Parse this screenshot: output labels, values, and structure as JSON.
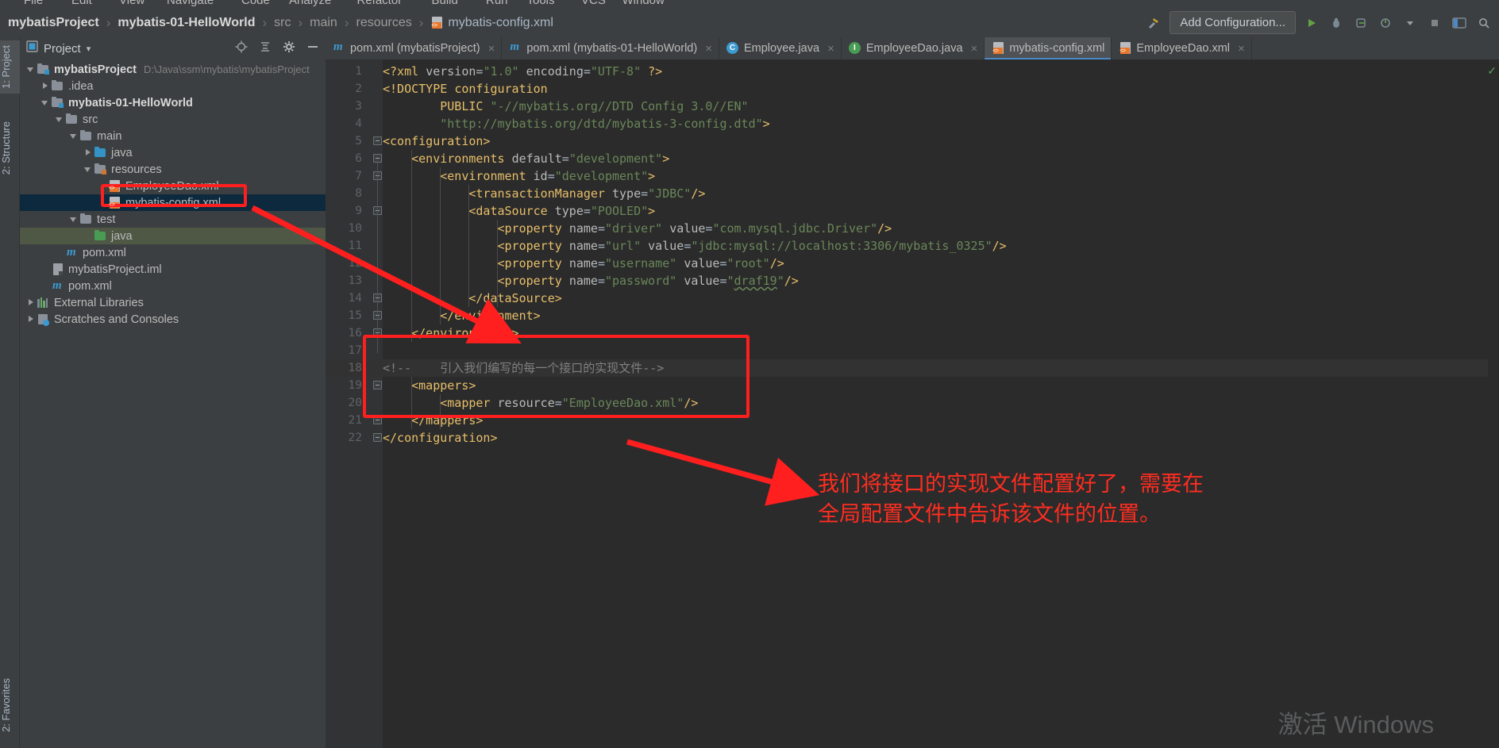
{
  "menu": {
    "items": [
      "File",
      "Edit",
      "View",
      "Navigate",
      "Code",
      "Analyze",
      "Refactor",
      "Build",
      "Run",
      "Tools",
      "VCS",
      "Window"
    ]
  },
  "breadcrumb": {
    "items": [
      {
        "label": "mybatisProject",
        "style": "bold"
      },
      {
        "label": "mybatis-01-HelloWorld",
        "style": "bold"
      },
      {
        "label": "src",
        "style": "dim"
      },
      {
        "label": "main",
        "style": "dim"
      },
      {
        "label": "resources",
        "style": "dim"
      },
      {
        "label": "mybatis-config.xml",
        "style": "file"
      }
    ],
    "separator": "›"
  },
  "toolbar": {
    "add_configuration": "Add Configuration...",
    "icons": [
      "hammer-icon",
      "run-icon",
      "debug-icon",
      "coverage-icon",
      "profile-icon",
      "dropdown-icon",
      "stop-icon",
      "layout-icon",
      "search-icon"
    ]
  },
  "left_strip": {
    "tabs": [
      {
        "label": "1: Project",
        "active": true
      },
      {
        "label": "2: Structure",
        "active": false
      }
    ],
    "favorites": "2: Favorites"
  },
  "project_panel": {
    "title": "Project",
    "dropdown": "▾",
    "icons": [
      "locate-icon",
      "collapse-all-icon",
      "settings-icon",
      "hide-icon"
    ]
  },
  "tree": {
    "nodes": [
      {
        "indent": 0,
        "arrow": "down",
        "icon": "module-folder",
        "label": "mybatisProject",
        "bold": true,
        "path": "D:\\Java\\ssm\\mybatis\\mybatisProject",
        "state": "normal"
      },
      {
        "indent": 1,
        "arrow": "right",
        "icon": "folder",
        "label": ".idea",
        "bold": false,
        "path": "",
        "state": "normal"
      },
      {
        "indent": 1,
        "arrow": "down",
        "icon": "module-folder",
        "label": "mybatis-01-HelloWorld",
        "bold": true,
        "path": "",
        "state": "normal"
      },
      {
        "indent": 2,
        "arrow": "down",
        "icon": "folder",
        "label": "src",
        "bold": false,
        "path": "",
        "state": "normal"
      },
      {
        "indent": 3,
        "arrow": "down",
        "icon": "folder",
        "label": "main",
        "bold": false,
        "path": "",
        "state": "normal"
      },
      {
        "indent": 4,
        "arrow": "right",
        "icon": "folder-blue",
        "label": "java",
        "bold": false,
        "path": "",
        "state": "normal"
      },
      {
        "indent": 4,
        "arrow": "down",
        "icon": "folder-res",
        "label": "resources",
        "bold": false,
        "path": "",
        "state": "normal"
      },
      {
        "indent": 5,
        "arrow": "none",
        "icon": "xml-file",
        "label": "EmployeeDao.xml",
        "bold": false,
        "path": "",
        "state": "normal"
      },
      {
        "indent": 5,
        "arrow": "none",
        "icon": "xml-file",
        "label": "mybatis-config.xml",
        "bold": false,
        "path": "",
        "state": "selected"
      },
      {
        "indent": 3,
        "arrow": "down",
        "icon": "folder",
        "label": "test",
        "bold": false,
        "path": "",
        "state": "normal"
      },
      {
        "indent": 4,
        "arrow": "none",
        "icon": "folder-green",
        "label": "java",
        "bold": false,
        "path": "",
        "state": "green"
      },
      {
        "indent": 2,
        "arrow": "none",
        "icon": "maven-file",
        "label": "pom.xml",
        "bold": false,
        "path": "",
        "state": "normal"
      },
      {
        "indent": 1,
        "arrow": "none",
        "icon": "iml-file",
        "label": "mybatisProject.iml",
        "bold": false,
        "path": "",
        "state": "normal"
      },
      {
        "indent": 1,
        "arrow": "none",
        "icon": "maven-file",
        "label": "pom.xml",
        "bold": false,
        "path": "",
        "state": "normal"
      },
      {
        "indent": 0,
        "arrow": "right",
        "icon": "libraries",
        "label": "External Libraries",
        "bold": false,
        "path": "",
        "state": "normal"
      },
      {
        "indent": 0,
        "arrow": "right",
        "icon": "scratches",
        "label": "Scratches and Consoles",
        "bold": false,
        "path": "",
        "state": "normal"
      }
    ]
  },
  "tabs": [
    {
      "label": "pom.xml (mybatisProject)",
      "icon": "maven-icon",
      "active": false,
      "closable": true
    },
    {
      "label": "pom.xml (mybatis-01-HelloWorld)",
      "icon": "maven-icon",
      "active": false,
      "closable": true
    },
    {
      "label": "Employee.java",
      "icon": "class-icon",
      "active": false,
      "closable": true
    },
    {
      "label": "EmployeeDao.java",
      "icon": "interface-icon",
      "active": false,
      "closable": true
    },
    {
      "label": "mybatis-config.xml",
      "icon": "xml-icon",
      "active": true,
      "closable": false
    },
    {
      "label": "EmployeeDao.xml",
      "icon": "xml-icon",
      "active": false,
      "closable": true
    }
  ],
  "editor": {
    "filename": "mybatis-config.xml",
    "highlighted_line": 18,
    "lines": [
      {
        "n": 1,
        "indent": 0,
        "fold": false,
        "html": "<span class='cl-pi'>&lt;?xml</span> <span class='cl-attr'>version</span>=<span class='cl-str'>\"1.0\"</span> <span class='cl-attr'>encoding</span>=<span class='cl-str'>\"UTF-8\"</span> <span class='cl-pi'>?&gt;</span>",
        "text": "<?xml version=\"1.0\" encoding=\"UTF-8\" ?>"
      },
      {
        "n": 2,
        "indent": 0,
        "fold": false,
        "html": "<span class='cl-kw'>&lt;!DOCTYPE</span> <span class='cl-kw'>configuration</span>",
        "text": "<!DOCTYPE configuration"
      },
      {
        "n": 3,
        "indent": 0,
        "fold": false,
        "html": "        <span class='cl-kw'>PUBLIC</span> <span class='cl-str'>\"-//mybatis.org//DTD Config 3.0//EN\"</span>",
        "text": "        PUBLIC \"-//mybatis.org//DTD Config 3.0//EN\""
      },
      {
        "n": 4,
        "indent": 0,
        "fold": false,
        "html": "        <span class='cl-str'>\"http://mybatis.org/dtd/mybatis-3-config.dtd\"</span><span class='cl-kw'>&gt;</span>",
        "text": "        \"http://mybatis.org/dtd/mybatis-3-config.dtd\">"
      },
      {
        "n": 5,
        "indent": 0,
        "fold": true,
        "html": "<span class='cl-tag'>&lt;configuration&gt;</span>",
        "text": "<configuration>"
      },
      {
        "n": 6,
        "indent": 1,
        "fold": true,
        "html": "    <span class='cl-tag'>&lt;environments</span> <span class='cl-attr'>default</span>=<span class='cl-str'>\"development\"</span><span class='cl-tag'>&gt;</span>",
        "text": "    <environments default=\"development\">"
      },
      {
        "n": 7,
        "indent": 2,
        "fold": true,
        "html": "        <span class='cl-tag'>&lt;environment</span> <span class='cl-attr'>id</span>=<span class='cl-str'>\"development\"</span><span class='cl-tag'>&gt;</span>",
        "text": "        <environment id=\"development\">"
      },
      {
        "n": 8,
        "indent": 3,
        "fold": false,
        "html": "            <span class='cl-tag'>&lt;transactionManager</span> <span class='cl-attr'>type</span>=<span class='cl-str'>\"JDBC\"</span><span class='cl-tag'>/&gt;</span>",
        "text": "            <transactionManager type=\"JDBC\"/>"
      },
      {
        "n": 9,
        "indent": 3,
        "fold": true,
        "html": "            <span class='cl-tag'>&lt;dataSource</span> <span class='cl-attr'>type</span>=<span class='cl-str'>\"POOLED\"</span><span class='cl-tag'>&gt;</span>",
        "text": "            <dataSource type=\"POOLED\">"
      },
      {
        "n": 10,
        "indent": 4,
        "fold": false,
        "html": "                <span class='cl-tag'>&lt;property</span> <span class='cl-attr'>name</span>=<span class='cl-str'>\"driver\"</span> <span class='cl-attr'>value</span>=<span class='cl-str'>\"com.mysql.jdbc.Driver\"</span><span class='cl-tag'>/&gt;</span>",
        "text": "                <property name=\"driver\" value=\"com.mysql.jdbc.Driver\"/>"
      },
      {
        "n": 11,
        "indent": 4,
        "fold": false,
        "html": "                <span class='cl-tag'>&lt;property</span> <span class='cl-attr'>name</span>=<span class='cl-str'>\"url\"</span> <span class='cl-attr'>value</span>=<span class='cl-str'>\"jdbc:mysql://localhost:3306/mybatis_0325\"</span><span class='cl-tag'>/&gt;</span>",
        "text": "                <property name=\"url\" value=\"jdbc:mysql://localhost:3306/mybatis_0325\"/>"
      },
      {
        "n": 12,
        "indent": 4,
        "fold": false,
        "html": "                <span class='cl-tag'>&lt;property</span> <span class='cl-attr'>name</span>=<span class='cl-str'>\"username\"</span> <span class='cl-attr'>value</span>=<span class='cl-str'>\"root\"</span><span class='cl-tag'>/&gt;</span>",
        "text": "                <property name=\"username\" value=\"root\"/>"
      },
      {
        "n": 13,
        "indent": 4,
        "fold": false,
        "html": "                <span class='cl-tag'>&lt;property</span> <span class='cl-attr'>name</span>=<span class='cl-str'>\"password\"</span> <span class='cl-attr'>value</span>=<span class='cl-str'>\"</span><span class='cl-under'>draf19</span><span class='cl-str'>\"</span><span class='cl-tag'>/&gt;</span>",
        "text": "                <property name=\"password\" value=\"draf19\"/>"
      },
      {
        "n": 14,
        "indent": 3,
        "fold": true,
        "html": "            <span class='cl-tag'>&lt;/dataSource&gt;</span>",
        "text": "            </dataSource>"
      },
      {
        "n": 15,
        "indent": 2,
        "fold": true,
        "html": "        <span class='cl-tag'>&lt;/environment&gt;</span>",
        "text": "        </environment>"
      },
      {
        "n": 16,
        "indent": 1,
        "fold": true,
        "html": "    <span class='cl-tag'>&lt;/environments&gt;</span>",
        "text": "    </environments>"
      },
      {
        "n": 17,
        "indent": 0,
        "fold": false,
        "html": "",
        "text": ""
      },
      {
        "n": 18,
        "indent": 0,
        "fold": false,
        "html": "<span class='cl-cmt'>&lt;!--    引入我们编写的每一个接口的实现文件--&gt;</span>",
        "text": "<!--    引入我们编写的每一个接口的实现文件-->"
      },
      {
        "n": 19,
        "indent": 1,
        "fold": true,
        "html": "    <span class='cl-tag'>&lt;mappers&gt;</span>",
        "text": "    <mappers>"
      },
      {
        "n": 20,
        "indent": 2,
        "fold": false,
        "html": "        <span class='cl-tag'>&lt;mapper</span> <span class='cl-attr'>resource</span>=<span class='cl-str'>\"EmployeeDao.xml\"</span><span class='cl-tag'>/&gt;</span>",
        "text": "        <mapper resource=\"EmployeeDao.xml\"/>"
      },
      {
        "n": 21,
        "indent": 1,
        "fold": true,
        "html": "    <span class='cl-tag'>&lt;/mappers&gt;</span>",
        "text": "    </mappers>"
      },
      {
        "n": 22,
        "indent": 0,
        "fold": true,
        "html": "<span class='cl-tag'>&lt;/configuration&gt;</span>",
        "text": "</configuration>"
      }
    ]
  },
  "annotations": {
    "color": "#ff1f1f",
    "note_text": "我们将接口的实现文件配置好了，需要在\n全局配置文件中告诉该文件的位置。",
    "boxes": [
      "tree-mybatis-config-highlight",
      "code-mappers-block-highlight"
    ],
    "arrows": [
      "tree-to-code-arrow",
      "code-to-note-arrow"
    ]
  },
  "watermark": "激活 Windows"
}
